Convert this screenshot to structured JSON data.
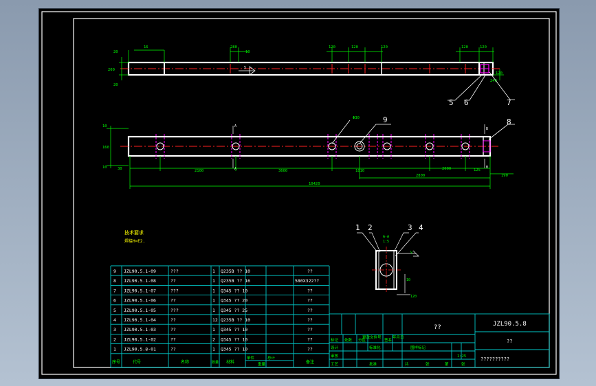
{
  "colors": {
    "background": "#000000",
    "frame": "#ffffff",
    "table": "#00c8c8",
    "text": "#00ff00",
    "center_line": "#ff2020",
    "hole": "#ff00ff",
    "dimension": "#00ff00"
  },
  "top_view": {
    "dims_top": [
      "16",
      "280",
      "10",
      "120",
      "120",
      "120",
      "120",
      "120"
    ],
    "dims_left": [
      "20",
      "200",
      "20"
    ],
    "dims_right": [
      "120",
      "240"
    ],
    "callouts": [
      "5",
      "6",
      "7"
    ]
  },
  "front_view": {
    "dims_left": [
      "10",
      "160",
      "10"
    ],
    "dims_bottom": [
      "30",
      "2100",
      "3600",
      "1810",
      "2800",
      "2000",
      "125",
      "190"
    ],
    "total_length": "10420",
    "dim_callout_hole": "Φ30",
    "section_marks": [
      "A",
      "A",
      "B",
      "B"
    ],
    "callouts": [
      "9",
      "8"
    ]
  },
  "tech_req": {
    "title": "技术要求",
    "line1": "焊接H=E2."
  },
  "section_view": {
    "labels": [
      "1",
      "2",
      "3",
      "4"
    ],
    "section_title": "A-A",
    "section_scale": "1:5",
    "weld_mark": "V",
    "dim_bottom": "120",
    "dim_side": "10"
  },
  "bom": {
    "rows": [
      {
        "no": "9",
        "code": "JZL90.5.1-09",
        "name": "???",
        "qty": "1",
        "material": "Q235B ?? 10",
        "weight": "",
        "note": "??"
      },
      {
        "no": "8",
        "code": "JZL90.5.1-08",
        "name": "??",
        "qty": "1",
        "material": "Q235B ?? 16",
        "weight": "",
        "note": "580X322??"
      },
      {
        "no": "7",
        "code": "JZL90.5.1-07",
        "name": "???",
        "qty": "1",
        "material": "Q345 ?? 10",
        "weight": "",
        "note": "??"
      },
      {
        "no": "6",
        "code": "JZL90.5.1-06",
        "name": "??",
        "qty": "1",
        "material": "Q345 ?? 20",
        "weight": "",
        "note": "??"
      },
      {
        "no": "5",
        "code": "JZL90.5.1-05",
        "name": "???",
        "qty": "1",
        "material": "Q345 ?? 25",
        "weight": "",
        "note": "??"
      },
      {
        "no": "4",
        "code": "JZL90.5.1-04",
        "name": "??",
        "qty": "12",
        "material": "Q235B ?? 10",
        "weight": "",
        "note": "??"
      },
      {
        "no": "3",
        "code": "JZL90.5.1-03",
        "name": "??",
        "qty": "1",
        "material": "Q345 ?? 10",
        "weight": "",
        "note": "??"
      },
      {
        "no": "2",
        "code": "JZL90.5.1-02",
        "name": "??",
        "qty": "2",
        "material": "Q345 ?? 10",
        "weight": "",
        "note": "??"
      },
      {
        "no": "1",
        "code": "JZL90.5.8-01",
        "name": "??",
        "qty": "1",
        "material": "Q345 ?? 10",
        "weight": "",
        "note": "??"
      }
    ],
    "header": {
      "no": "序号",
      "code": "代号",
      "name": "名称",
      "qty": "数量",
      "material": "材料",
      "weight_single": "单件",
      "weight_total": "总计",
      "weight_label": "重量",
      "note": "备注"
    }
  },
  "title_block": {
    "drawing_no": "JZL90.5.8",
    "part_name": "??",
    "subtitle": "??",
    "company": "??????????",
    "scale": "1:25",
    "stage_label": "图样标记",
    "sheet_label": "共",
    "page_label": "第",
    "sheet_unit": "张",
    "page_unit": "张",
    "labels": [
      "标记",
      "处数",
      "分区",
      "更改文件号",
      "签名",
      "年月日",
      "设计",
      "标准化",
      "审核",
      "工艺",
      "批准"
    ]
  }
}
